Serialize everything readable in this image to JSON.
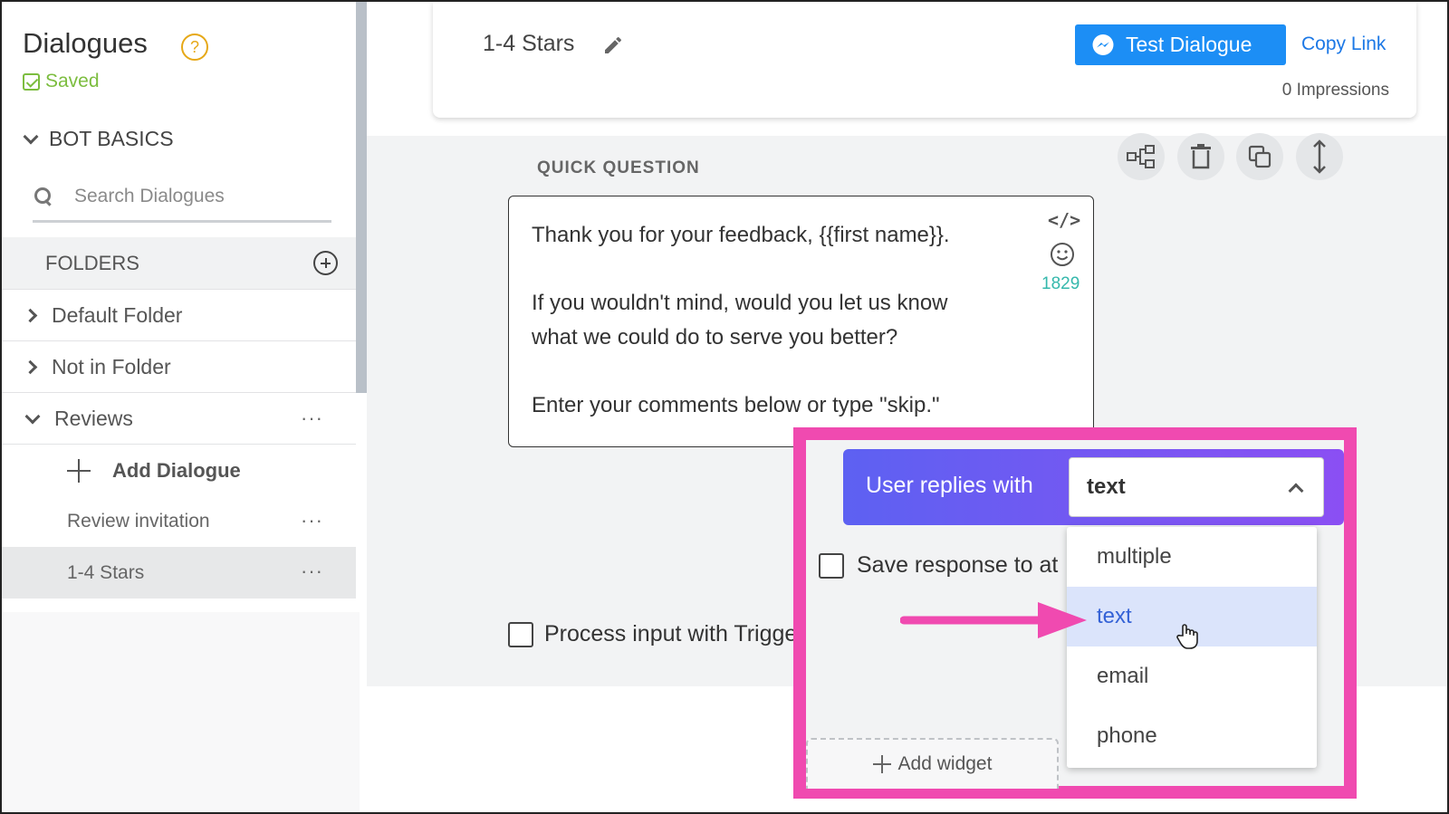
{
  "sidebar": {
    "title": "Dialogues",
    "help_glyph": "?",
    "saved_label": "Saved",
    "bot_basics_label": "BOT BASICS",
    "search_placeholder": "Search Dialogues",
    "folders_label": "FOLDERS",
    "folders": [
      {
        "label": "Default Folder"
      },
      {
        "label": "Not in Folder"
      },
      {
        "label": "Reviews"
      }
    ],
    "add_dialogue_label": "Add Dialogue",
    "dialogues": [
      {
        "label": "Review invitation"
      },
      {
        "label": "1-4 Stars"
      }
    ],
    "more_glyph": "···"
  },
  "header": {
    "dialogue_name": "1-4 Stars",
    "test_button_label": "Test Dialogue",
    "copy_link_label": "Copy Link",
    "impressions": "0 Impressions"
  },
  "editor": {
    "section_label": "QUICK QUESTION",
    "message_lines": [
      "Thank you for your feedback, {{first name}}.",
      "If you wouldn't mind, would you let us know",
      "what we could do to serve you better?",
      "Enter your comments below or type \"skip.\""
    ],
    "code_glyph": "</>",
    "char_count": "1829",
    "reply_label": "User replies with",
    "reply_selected": "text",
    "reply_options": [
      "multiple",
      "text",
      "email",
      "phone"
    ],
    "save_response_label": "Save response to at",
    "process_input_label": "Process input with Triggers",
    "add_widget_label": "Add widget"
  },
  "colors": {
    "primary": "#1c8ef5",
    "highlight": "#f04ab0",
    "saved_green": "#7cbd3f",
    "gradient_start": "#5d61f2",
    "gradient_end": "#8b4ff3"
  }
}
